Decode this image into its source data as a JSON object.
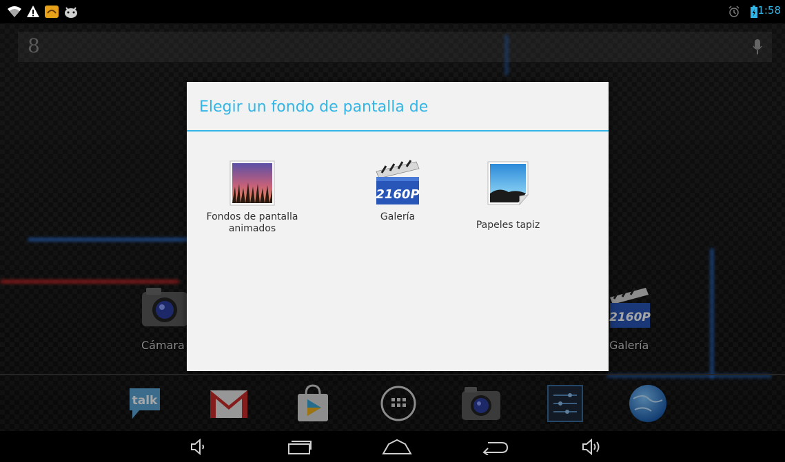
{
  "status_bar": {
    "time": "1:58",
    "left_icons": [
      "wifi-icon",
      "warning-icon",
      "notification-app-icon",
      "android-debug-icon"
    ],
    "right_icons": [
      "alarm-icon",
      "battery-icon"
    ]
  },
  "search_bar": {
    "logo": "8",
    "mic_icon": "mic-icon"
  },
  "desktop": {
    "camera_label": "Cámara",
    "gallery_label": "Galería",
    "gallery_badge": "2160P"
  },
  "dock": {
    "items": [
      {
        "name": "talk",
        "label": "talk"
      },
      {
        "name": "gmail",
        "label": ""
      },
      {
        "name": "play-store",
        "label": ""
      },
      {
        "name": "app-drawer",
        "label": ""
      },
      {
        "name": "camera",
        "label": ""
      },
      {
        "name": "settings",
        "label": ""
      },
      {
        "name": "browser",
        "label": ""
      }
    ]
  },
  "dialog": {
    "title": "Elegir un fondo de pantalla de",
    "options": [
      {
        "label": "Fondos de pantalla animados",
        "icon": "live-wallpaper-icon"
      },
      {
        "label": "Galería",
        "icon": "gallery-icon",
        "badge": "2160P"
      },
      {
        "label": "Papeles tapiz",
        "icon": "wallpaper-picture-icon"
      }
    ]
  },
  "navigation": {
    "buttons": [
      "volume-down-icon",
      "recent-apps-icon",
      "home-icon",
      "back-icon",
      "volume-up-icon"
    ]
  },
  "colors": {
    "accent": "#33b5e5",
    "dialog_bg": "#f2f2f2"
  }
}
